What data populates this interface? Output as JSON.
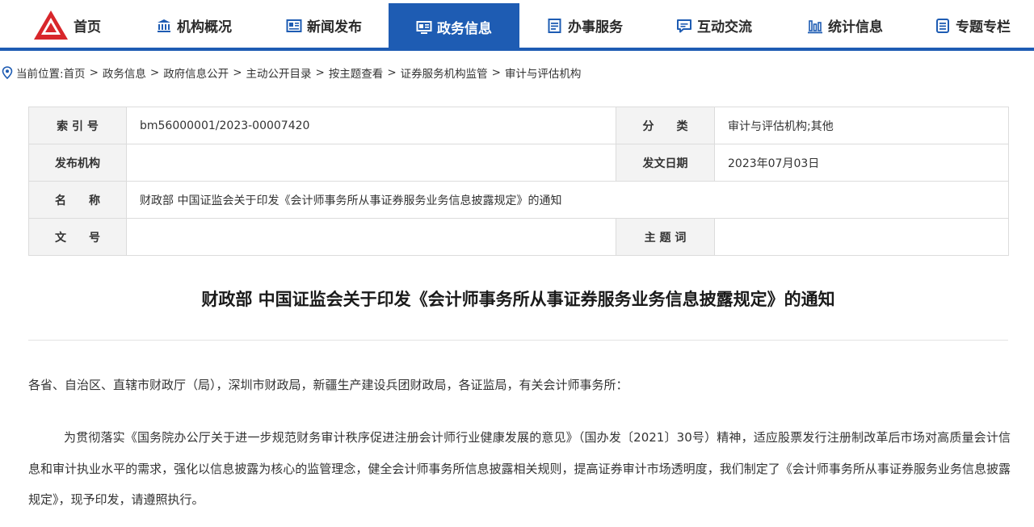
{
  "nav": {
    "items": [
      {
        "label": "首页",
        "icon": "logo-icon"
      },
      {
        "label": "机构概况",
        "icon": "building-icon"
      },
      {
        "label": "新闻发布",
        "icon": "news-icon"
      },
      {
        "label": "政务信息",
        "icon": "monitor-icon",
        "active": true
      },
      {
        "label": "办事服务",
        "icon": "list-icon"
      },
      {
        "label": "互动交流",
        "icon": "chat-icon"
      },
      {
        "label": "统计信息",
        "icon": "bar-chart-icon"
      },
      {
        "label": "专题专栏",
        "icon": "document-icon"
      }
    ],
    "accent": "#1e5cb3",
    "logo_color": "#d8262b"
  },
  "breadcrumb": {
    "prefix": "当前位置:",
    "items": [
      "首页",
      "政务信息",
      "政府信息公开",
      "主动公开目录",
      "按主题查看",
      "证券服务机构监管",
      "审计与评估机构"
    ],
    "separator": ">"
  },
  "meta": {
    "index_label": "索 引 号",
    "index_value": "bm56000001/2023-00007420",
    "category_label": "分　　类",
    "category_value": "审计与评估机构;其他",
    "publisher_label": "发布机构",
    "publisher_value": "",
    "date_label": "发文日期",
    "date_value": "2023年07月03日",
    "name_label": "名　　称",
    "name_value": "财政部 中国证监会关于印发《会计师事务所从事证券服务业务信息披露规定》的通知",
    "docno_label": "文　　号",
    "docno_value": "",
    "keyword_label": "主 题 词",
    "keyword_value": ""
  },
  "document": {
    "title": "财政部 中国证监会关于印发《会计师事务所从事证券服务业务信息披露规定》的通知",
    "salutation": "各省、自治区、直辖市财政厅（局），深圳市财政局，新疆生产建设兵团财政局，各证监局，有关会计师事务所：",
    "paragraph": "为贯彻落实《国务院办公厅关于进一步规范财务审计秩序促进注册会计师行业健康发展的意见》（国办发〔2021〕30号）精神，适应股票发行注册制改革后市场对高质量会计信息和审计执业水平的需求，强化以信息披露为核心的监管理念，健全会计师事务所信息披露相关规则，提高证券审计市场透明度，我们制定了《会计师事务所从事证券服务业务信息披露规定》，现予印发，请遵照执行。"
  }
}
